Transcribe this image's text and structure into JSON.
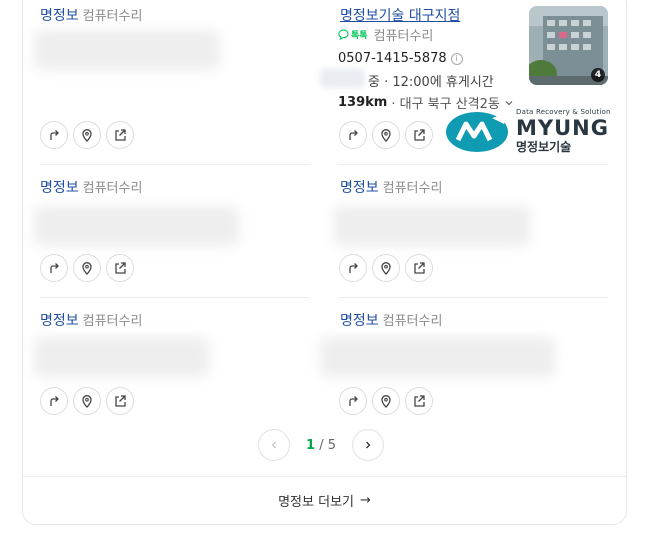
{
  "colors": {
    "name_blue": "#1f4fa3",
    "accent_green": "#03c75a",
    "logo_teal": "#0f9bb2",
    "logo_dark": "#2b3740"
  },
  "results": [
    {
      "name": "명정보",
      "category": "컴퓨터수리"
    },
    {
      "name": "명정보기술 대구지점",
      "category": "컴퓨터수리",
      "talk_label": "톡톡",
      "phone": "0507-1415-5878",
      "hours_status": "중 · 12:00에 휴게시간",
      "distance": "139km",
      "address": "· 대구 북구 산격2동",
      "photo_count": "4"
    },
    {
      "name": "명정보",
      "category": "컴퓨터수리"
    },
    {
      "name": "명정보",
      "category": "컴퓨터수리"
    },
    {
      "name": "명정보",
      "category": "컴퓨터수리"
    },
    {
      "name": "명정보",
      "category": "컴퓨터수리"
    }
  ],
  "actions": {
    "directions_icon": "directions-icon",
    "map_icon": "map-pin-icon",
    "share_icon": "share-icon"
  },
  "logo": {
    "tagline": "Data Recovery & Solution",
    "wordmark": "MYUNG",
    "korean": "명정보기술"
  },
  "pagination": {
    "current": "1",
    "separator": "/",
    "total": "5"
  },
  "more_button": {
    "label": "명정보 더보기",
    "arrow": "→"
  }
}
